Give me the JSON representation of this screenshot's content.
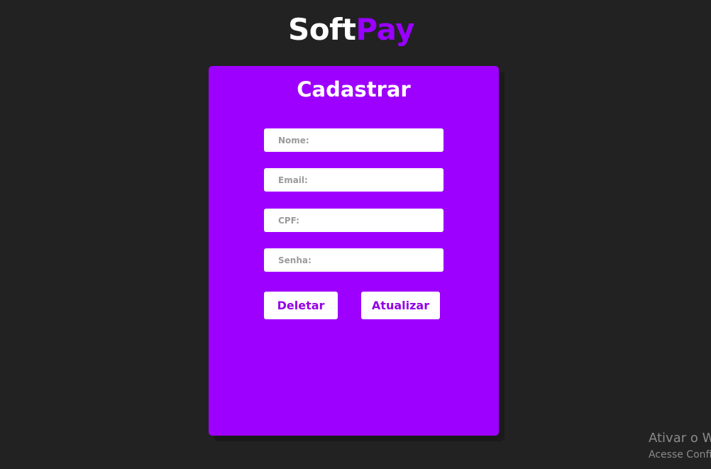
{
  "logo": {
    "part1": "Soft",
    "part2": "Pay"
  },
  "form": {
    "title": "Cadastrar",
    "fields": [
      {
        "placeholder": "Nome:",
        "value": ""
      },
      {
        "placeholder": "Email:",
        "value": ""
      },
      {
        "placeholder": "CPF:",
        "value": ""
      },
      {
        "placeholder": "Senha:",
        "value": ""
      }
    ],
    "buttons": {
      "delete_label": "Deletar",
      "update_label": "Atualizar"
    }
  },
  "watermark": {
    "line1": "Ativar o W",
    "line2": "Acesse Config"
  },
  "colors": {
    "background": "#222222",
    "accent": "#9e00ff",
    "logo_accent": "#9900ff",
    "button_text": "#9400e6"
  }
}
